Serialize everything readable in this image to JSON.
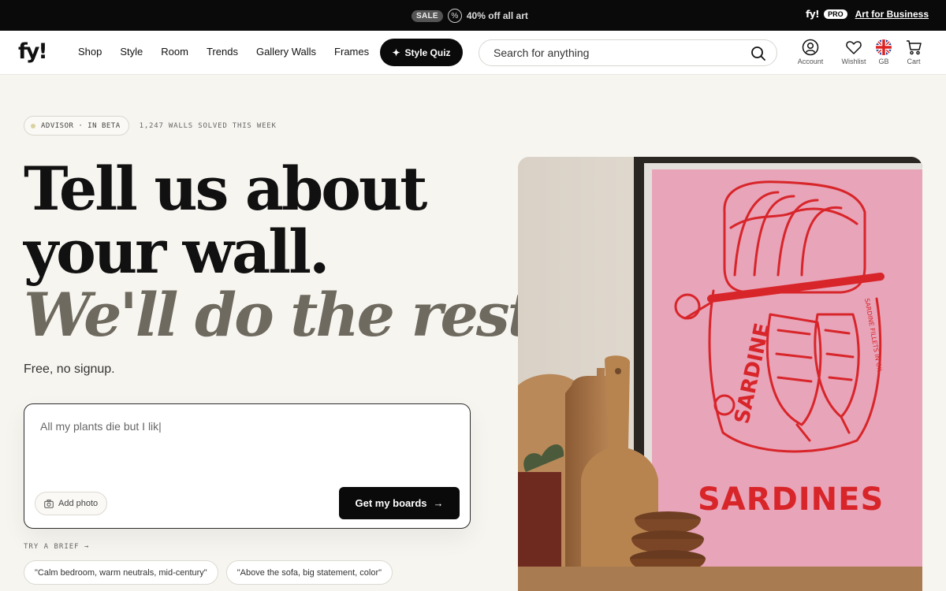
{
  "promo": {
    "sale_label": "SALE",
    "offer_text": "40% off all art",
    "pro_logo": "fy!",
    "pro_badge": "PRO",
    "business_link": "Art for Business"
  },
  "header": {
    "logo": "fy!",
    "nav": [
      "Shop",
      "Style",
      "Room",
      "Trends",
      "Gallery Walls",
      "Frames"
    ],
    "quiz_label": "Style Quiz",
    "search_placeholder": "Search for anything",
    "icons": [
      {
        "label": "Account",
        "icon": "account-icon"
      },
      {
        "label": "Wishlist",
        "icon": "heart-icon"
      },
      {
        "label": "GB",
        "icon": "uk-flag-icon"
      },
      {
        "label": "Cart",
        "icon": "cart-icon"
      }
    ]
  },
  "hero": {
    "badge": "ADVISOR · IN BETA",
    "stats": "1,247 WALLS SOLVED THIS WEEK",
    "headline_line1": "Tell us about",
    "headline_line2": "your wall.",
    "headline_line3": "We'll do the rest.",
    "subtitle": "Free, no signup.",
    "input_value": "All my plants die but I lik|",
    "add_photo": "Add photo",
    "cta": "Get my boards",
    "try_label": "TRY A BRIEF →",
    "chips": [
      "\"Calm bedroom, warm neutrals, mid-century\"",
      "\"Above the sofa, big statement, color\""
    ]
  },
  "artwork": {
    "title": "SARDINES",
    "can_text": "SARDINE",
    "can_side_text": "SARDINE FILLETS IN OIL",
    "colors": {
      "pink": "#e8a3b6",
      "red": "#d8252a",
      "wood": "#a8764a"
    }
  }
}
